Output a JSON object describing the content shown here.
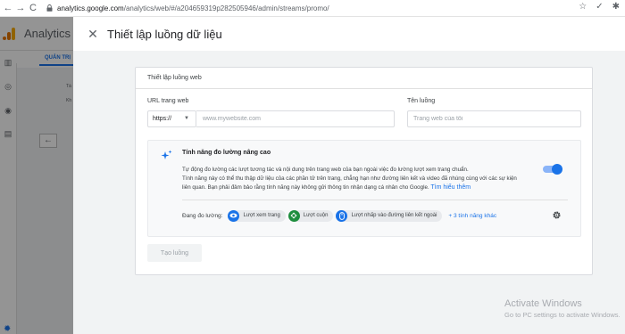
{
  "browser": {
    "back_icon": "←",
    "forward_icon": "→",
    "reload_icon": "C",
    "url_host": "analytics.google.com",
    "url_path": "/analytics/web/#/a204659319p282505946/admin/streams/promo/"
  },
  "app": {
    "title": "Analytics",
    "admin_tab": "QUẢN TRỊ",
    "bg_text_1": "Tà",
    "bg_text_2": "Kh"
  },
  "panel": {
    "title": "Thiết lập luồng dữ liệu",
    "card_title": "Thiết lập luồng web",
    "url_label": "URL trang web",
    "protocol_value": "https://",
    "url_placeholder": "www.mywebsite.com",
    "name_label": "Tên luồng",
    "name_placeholder": "Trang web của tôi",
    "enhanced": {
      "title": "Tính năng đo lường nâng cao",
      "desc_line1": "Tự động đo lường các lượt tương tác và nội dung trên trang web của bạn ngoài việc đo lường lượt xem trang chuẩn.",
      "desc_line2": "Tính năng này có thể thu thập dữ liệu của các phần tử trên trang, chẳng hạn như đường liên kết và video đã nhúng cùng với các sự kiện",
      "desc_line3": "liên quan. Bạn phải đảm bảo rằng tính năng này không gửi thông tin nhận dạng cá nhân cho Google.",
      "learn_more": "Tìm hiểu thêm",
      "toggle_on": true,
      "measuring_label": "Đang đo lường:",
      "chips": [
        "Lượt xem trang",
        "Lượt cuộn",
        "Lượt nhấp vào đường liên kết ngoài"
      ],
      "more_features": "+ 3 tính năng khác"
    },
    "create_button": "Tạo luồng"
  },
  "watermark": {
    "line1": "Activate Windows",
    "line2": "Go to PC settings to activate Windows."
  },
  "colors": {
    "accent": "#1a73e8",
    "green": "#1e8e3e",
    "ga_orange": "#f9ab00"
  }
}
